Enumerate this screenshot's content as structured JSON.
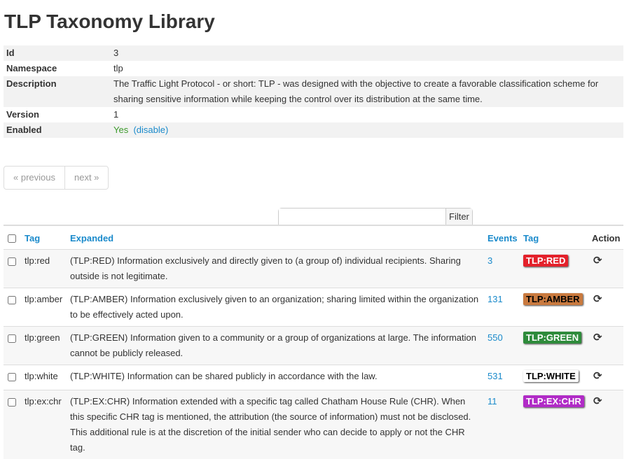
{
  "page": {
    "title": "TLP Taxonomy Library"
  },
  "info": {
    "rows": [
      {
        "key": "Id",
        "value": "3"
      },
      {
        "key": "Namespace",
        "value": "tlp"
      },
      {
        "key": "Description",
        "value": "The Traffic Light Protocol - or short: TLP - was designed with the objective to create a favorable classification scheme for sharing sensitive information while keeping the control over its distribution at the same time."
      },
      {
        "key": "Version",
        "value": "1"
      }
    ],
    "enabled": {
      "key": "Enabled",
      "value": "Yes",
      "action": "(disable)"
    }
  },
  "pager": {
    "previous": "« previous",
    "next": "next »"
  },
  "filter": {
    "placeholder": "",
    "button": "Filter"
  },
  "table": {
    "headers": {
      "tag": "Tag",
      "expanded": "Expanded",
      "events": "Events",
      "tag2": "Tag",
      "action": "Action"
    },
    "rows": [
      {
        "tag": "tlp:red",
        "expanded": "(TLP:RED) Information exclusively and directly given to (a group of) individual recipients. Sharing outside is not legitimate.",
        "events": "3",
        "badge": "TLP:RED",
        "badge_bg": "#e4212b",
        "badge_fg": "#ffffff",
        "action_icon": "refresh-icon"
      },
      {
        "tag": "tlp:amber",
        "expanded": "(TLP:AMBER) Information exclusively given to an organization; sharing limited within the organization to be effectively acted upon.",
        "events": "131",
        "badge": "TLP:AMBER",
        "badge_bg": "#c97a3f",
        "badge_fg": "#000000",
        "action_icon": "refresh-icon"
      },
      {
        "tag": "tlp:green",
        "expanded": "(TLP:GREEN) Information given to a community or a group of organizations at large. The information cannot be publicly released.",
        "events": "550",
        "badge": "TLP:GREEN",
        "badge_bg": "#2e8b3b",
        "badge_fg": "#ffffff",
        "action_icon": "refresh-icon"
      },
      {
        "tag": "tlp:white",
        "expanded": "(TLP:WHITE) Information can be shared publicly in accordance with the law.",
        "events": "531",
        "badge": "TLP:WHITE",
        "badge_bg": "#ffffff",
        "badge_fg": "#000000",
        "action_icon": "refresh-icon"
      },
      {
        "tag": "tlp:ex:chr",
        "expanded": "(TLP:EX:CHR) Information extended with a specific tag called Chatham House Rule (CHR). When this specific CHR tag is mentioned, the attribution (the source of information) must not be disclosed. This additional rule is at the discretion of the initial sender who can decide to apply or not the CHR tag.",
        "events": "11",
        "badge": "TLP:EX:CHR",
        "badge_bg": "#b12bc7",
        "badge_fg": "#ffffff",
        "action_icon": "refresh-icon"
      }
    ]
  }
}
